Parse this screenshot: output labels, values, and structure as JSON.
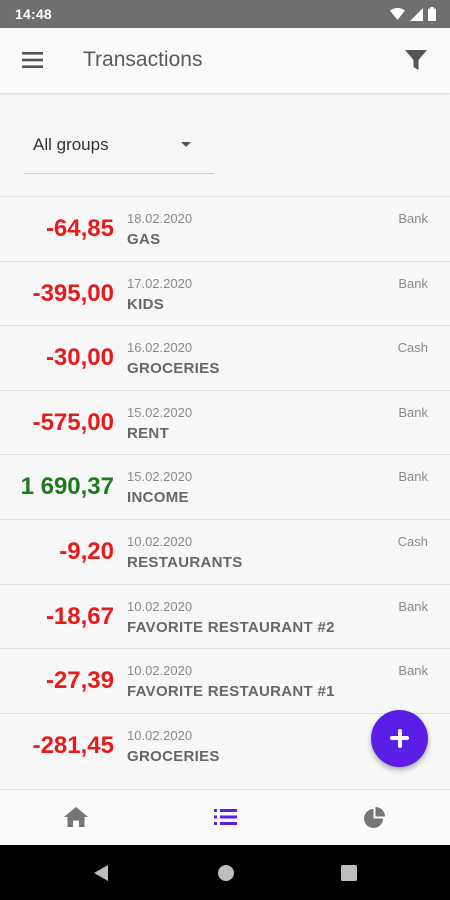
{
  "status_bar": {
    "time": "14:48"
  },
  "app_bar": {
    "title": "Transactions",
    "menu_icon": "hamburger-menu-icon",
    "filter_icon": "filter-icon"
  },
  "group_filter": {
    "selected": "All groups"
  },
  "transactions": [
    {
      "amount": "-64,85",
      "type": "expense",
      "date": "18.02.2020",
      "name": "GAS",
      "account": "Bank"
    },
    {
      "amount": "-395,00",
      "type": "expense",
      "date": "17.02.2020",
      "name": "KIDS",
      "account": "Bank"
    },
    {
      "amount": "-30,00",
      "type": "expense",
      "date": "16.02.2020",
      "name": "GROCERIES",
      "account": "Cash"
    },
    {
      "amount": "-575,00",
      "type": "expense",
      "date": "15.02.2020",
      "name": "RENT",
      "account": "Bank"
    },
    {
      "amount": "1 690,37",
      "type": "income",
      "date": "15.02.2020",
      "name": "INCOME",
      "account": "Bank"
    },
    {
      "amount": "-9,20",
      "type": "expense",
      "date": "10.02.2020",
      "name": "RESTAURANTS",
      "account": "Cash"
    },
    {
      "amount": "-18,67",
      "type": "expense",
      "date": "10.02.2020",
      "name": "FAVORITE RESTAURANT #2",
      "account": "Bank"
    },
    {
      "amount": "-27,39",
      "type": "expense",
      "date": "10.02.2020",
      "name": "FAVORITE RESTAURANT #1",
      "account": "Bank"
    },
    {
      "amount": "-281,45",
      "type": "expense",
      "date": "10.02.2020",
      "name": "GROCERIES",
      "account": ""
    }
  ],
  "fab": {
    "icon": "plus-icon"
  },
  "bottom_nav": [
    {
      "icon": "home-icon",
      "active": false
    },
    {
      "icon": "list-icon",
      "active": true
    },
    {
      "icon": "pie-chart-icon",
      "active": false
    }
  ],
  "colors": {
    "expense": "#e81b1b",
    "income": "#1d7a1d",
    "accent": "#5b1ee6",
    "status_bar": "#6f6f6f"
  }
}
